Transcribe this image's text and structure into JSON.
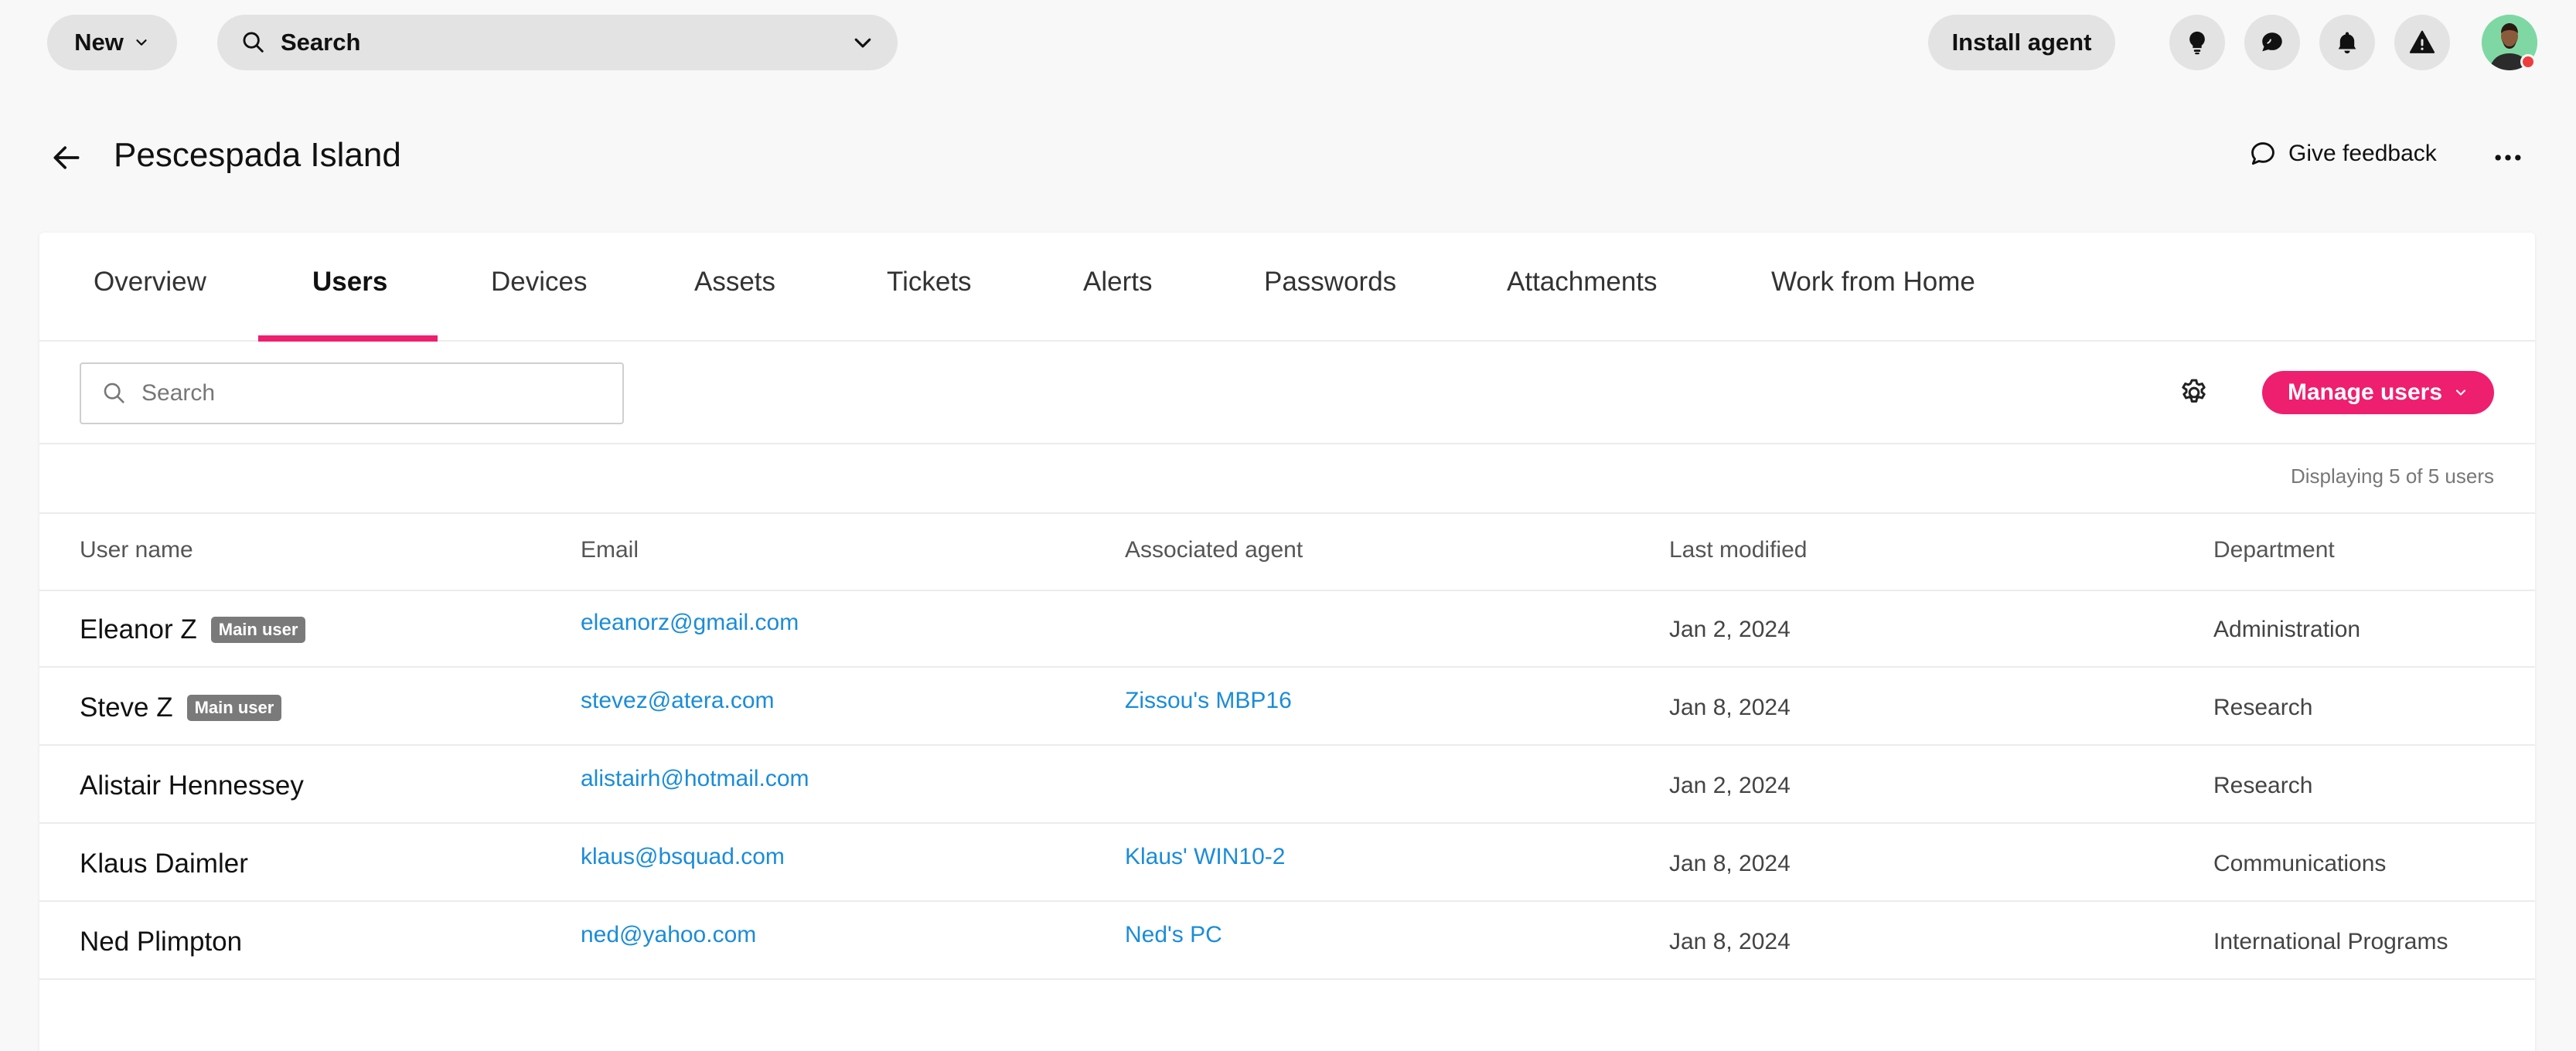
{
  "topbar": {
    "new_label": "New",
    "search_label": "Search",
    "install_label": "Install agent",
    "icons": [
      "lightbulb-icon",
      "chat-icon",
      "bell-icon",
      "warning-icon"
    ]
  },
  "header": {
    "title": "Pescespada Island",
    "feedback_label": "Give feedback"
  },
  "tabs": [
    {
      "label": "Overview"
    },
    {
      "label": "Users"
    },
    {
      "label": "Devices"
    },
    {
      "label": "Assets"
    },
    {
      "label": "Tickets"
    },
    {
      "label": "Alerts"
    },
    {
      "label": "Passwords"
    },
    {
      "label": "Attachments"
    },
    {
      "label": "Work from Home"
    }
  ],
  "active_tab": "Users",
  "toolbar": {
    "search_placeholder": "Search",
    "manage_label": "Manage users"
  },
  "display_count": "Displaying 5 of 5 users",
  "table": {
    "columns": [
      "User name",
      "Email",
      "Associated agent",
      "Last modified",
      "Department"
    ],
    "rows": [
      {
        "name": "Eleanor Z",
        "badge": "Main user",
        "email": "eleanorz@gmail.com",
        "agent": "",
        "modified": "Jan 2, 2024",
        "department": "Administration"
      },
      {
        "name": "Steve Z",
        "badge": "Main user",
        "email": "stevez@atera.com",
        "agent": "Zissou's MBP16",
        "modified": "Jan 8, 2024",
        "department": "Research"
      },
      {
        "name": "Alistair Hennessey",
        "badge": "",
        "email": "alistairh@hotmail.com",
        "agent": "",
        "modified": "Jan 2, 2024",
        "department": "Research"
      },
      {
        "name": "Klaus Daimler",
        "badge": "",
        "email": "klaus@bsquad.com",
        "agent": "Klaus' WIN10-2",
        "modified": "Jan 8, 2024",
        "department": "Communications"
      },
      {
        "name": "Ned Plimpton",
        "badge": "",
        "email": "ned@yahoo.com",
        "agent": "Ned's PC",
        "modified": "Jan 8, 2024",
        "department": "International Programs"
      }
    ]
  },
  "colors": {
    "accent": "#ee1f6e",
    "link": "#1b8cd8",
    "badge": "#7a7a7a"
  }
}
